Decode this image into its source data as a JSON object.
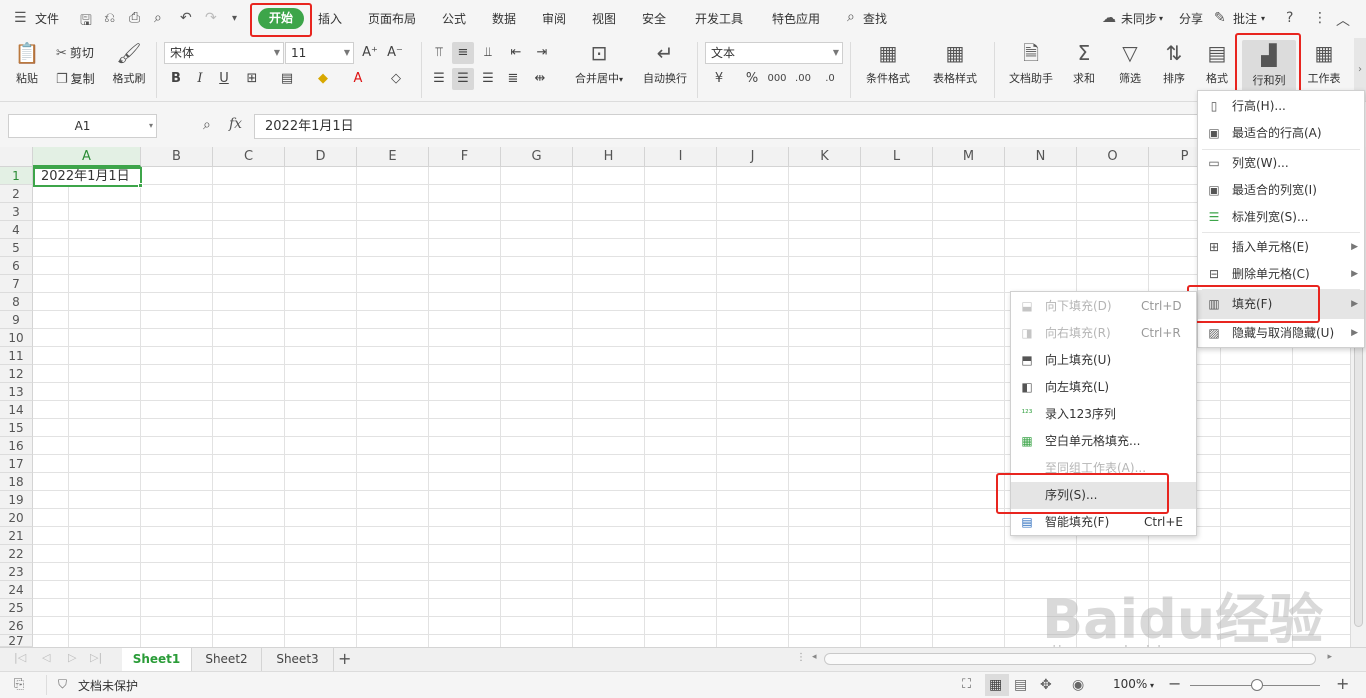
{
  "menubar": {
    "file_menu": "文件",
    "tabs": [
      "开始",
      "插入",
      "页面布局",
      "公式",
      "数据",
      "审阅",
      "视图",
      "安全",
      "开发工具",
      "特色应用"
    ],
    "search": "查找",
    "sync": "未同步",
    "share": "分享",
    "comment": "批注"
  },
  "ribbon": {
    "paste": "粘贴",
    "cut": "剪切",
    "copy": "复制",
    "format_painter": "格式刷",
    "font_name": "宋体",
    "font_size": "11",
    "merge_center": "合并居中",
    "wrap_text": "自动换行",
    "number_format": "文本",
    "doc_assistant": "文档助手",
    "sum": "求和",
    "filter": "筛选",
    "sort": "排序",
    "format": "格式",
    "rows_cols": "行和列",
    "worksheet": "工作表",
    "conditional_format": "条件格式",
    "table_style": "表格样式"
  },
  "formula": {
    "name_box": "A1",
    "content": "2022年1月1日"
  },
  "grid": {
    "columns": [
      "A",
      "B",
      "C",
      "D",
      "E",
      "F",
      "G",
      "H",
      "I",
      "J",
      "K",
      "L",
      "M",
      "N",
      "O",
      "P"
    ],
    "rows": [
      "1",
      "2",
      "3",
      "4",
      "5",
      "6",
      "7",
      "8",
      "9",
      "10",
      "11",
      "12",
      "13",
      "14",
      "15",
      "16",
      "17",
      "18",
      "19",
      "20",
      "21",
      "22",
      "23",
      "24",
      "25",
      "26",
      "27"
    ],
    "a1_value": "2022年1月1日"
  },
  "rowcol_menu": {
    "items": [
      {
        "label": "行高(H)..."
      },
      {
        "label": "最适合的行高(A)"
      },
      {
        "label": "列宽(W)..."
      },
      {
        "label": "最适合的列宽(I)"
      },
      {
        "label": "标准列宽(S)..."
      },
      {
        "label": "插入单元格(E)"
      },
      {
        "label": "删除单元格(C)"
      },
      {
        "label": "填充(F)"
      },
      {
        "label": "隐藏与取消隐藏(U)"
      }
    ]
  },
  "fill_menu": {
    "items": [
      {
        "label": "向下填充(D)",
        "shortcut": "Ctrl+D"
      },
      {
        "label": "向右填充(R)",
        "shortcut": "Ctrl+R"
      },
      {
        "label": "向上填充(U)"
      },
      {
        "label": "向左填充(L)"
      },
      {
        "label": "录入123序列"
      },
      {
        "label": "空白单元格填充..."
      },
      {
        "label": "至同组工作表(A)..."
      },
      {
        "label": "序列(S)..."
      },
      {
        "label": "智能填充(F)",
        "shortcut": "Ctrl+E"
      }
    ]
  },
  "sheets": [
    "Sheet1",
    "Sheet2",
    "Sheet3"
  ],
  "status": {
    "protect": "文档未保护",
    "zoom": "100%"
  },
  "watermark": {
    "brand": "Baidu经验",
    "url": "jingyan.baidu.com"
  },
  "colors": {
    "accent": "#3da54a",
    "highlight_box": "#e8251f"
  }
}
